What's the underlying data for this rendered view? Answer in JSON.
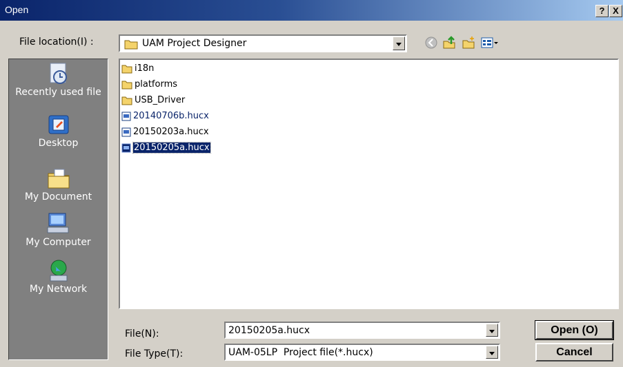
{
  "window": {
    "title": "Open",
    "help_label": "?",
    "close_label": "X"
  },
  "location": {
    "label": "File location(I) :",
    "value": "UAM Project Designer"
  },
  "toolbar": {
    "icons": [
      "back-icon",
      "up-folder-icon",
      "new-folder-icon",
      "view-menu-icon"
    ]
  },
  "places": [
    {
      "label": "Recently used file",
      "icon": "recent-files-icon"
    },
    {
      "label": "Desktop",
      "icon": "desktop-icon"
    },
    {
      "label": "My Document",
      "icon": "my-documents-icon"
    },
    {
      "label": "My Computer",
      "icon": "my-computer-icon"
    },
    {
      "label": "My Network",
      "icon": "network-icon"
    }
  ],
  "files": [
    {
      "name": "i18n",
      "type": "folder",
      "selected": false
    },
    {
      "name": "platforms",
      "type": "folder",
      "selected": false
    },
    {
      "name": "USB_Driver",
      "type": "folder",
      "selected": false
    },
    {
      "name": "20140706b.hucx",
      "type": "file",
      "selected": false
    },
    {
      "name": "20150203a.hucx",
      "type": "file",
      "selected": false
    },
    {
      "name": "20150205a.hucx",
      "type": "file",
      "selected": true
    }
  ],
  "filename": {
    "label": "File(N):",
    "value": "20150205a.hucx"
  },
  "filetype": {
    "label": "File Type(T):",
    "value": "UAM-05LP  Project file(*.hucx)"
  },
  "buttons": {
    "open": "Open (O)",
    "cancel": "Cancel"
  },
  "colors": {
    "title_start": "#0a246a",
    "dialog_bg": "#d4d0c8",
    "places_bg": "#808080",
    "selection": "#0a246a"
  }
}
